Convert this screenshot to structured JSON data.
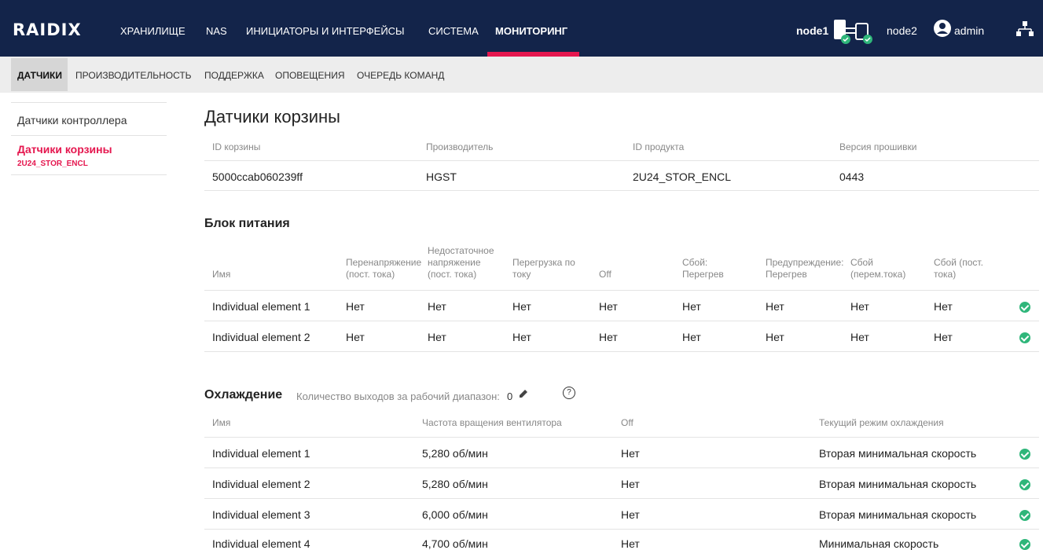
{
  "app": {
    "logo": "RAIDIX"
  },
  "topnav": {
    "items": [
      "ХРАНИЛИЩЕ",
      "NAS",
      "ИНИЦИАТОРЫ И ИНТЕРФЕЙСЫ",
      "СИСТЕМА",
      "МОНИТОРИНГ"
    ],
    "active_index": 4
  },
  "header": {
    "node1": "node1",
    "node2": "node2",
    "user": "admin"
  },
  "subnav": {
    "items": [
      "ДАТЧИКИ",
      "ПРОИЗВОДИТЕЛЬНОСТЬ",
      "ПОДДЕРЖКА",
      "ОПОВЕЩЕНИЯ",
      "ОЧЕРЕДЬ КОМАНД"
    ],
    "active_index": 0
  },
  "sidebar": {
    "items": [
      {
        "label": "Датчики контроллера",
        "sub": ""
      },
      {
        "label": "Датчики корзины",
        "sub": "2U24_STOR_ENCL"
      }
    ],
    "active_index": 1
  },
  "page": {
    "title": "Датчики корзины"
  },
  "enclosure": {
    "headers": [
      "ID корзины",
      "Производитель",
      "ID продукта",
      "Версия прошивки"
    ],
    "values": [
      "5000ccab060239ff",
      "HGST",
      "2U24_STOR_ENCL",
      "0443"
    ]
  },
  "psu": {
    "title": "Блок питания",
    "headers": [
      "Имя",
      "Перенапряжение (пост. тока)",
      "Недостаточное напряжение (пост. тока)",
      "Перегрузка по току",
      "Off",
      "Сбой: Перегрев",
      "Предупреждение: Перегрев",
      "Сбой (перем.тока)",
      "Сбой (пост. тока)"
    ],
    "rows": [
      {
        "name": "Individual element 1",
        "values": [
          "Нет",
          "Нет",
          "Нет",
          "Нет",
          "Нет",
          "Нет",
          "Нет",
          "Нет"
        ],
        "status": "ok"
      },
      {
        "name": "Individual element 2",
        "values": [
          "Нет",
          "Нет",
          "Нет",
          "Нет",
          "Нет",
          "Нет",
          "Нет",
          "Нет"
        ],
        "status": "ok"
      }
    ]
  },
  "cooling": {
    "title": "Охлаждение",
    "exits_label": "Количество выходов за рабочий диапазон:",
    "exits_value": "0",
    "help": "?",
    "headers": [
      "Имя",
      "Частота вращения вентилятора",
      "Off",
      "Текущий режим охлаждения"
    ],
    "rows": [
      {
        "name": "Individual element 1",
        "speed": "5,280 об/мин",
        "off": "Нет",
        "mode": "Вторая минимальная скорость",
        "status": "ok"
      },
      {
        "name": "Individual element 2",
        "speed": "5,280 об/мин",
        "off": "Нет",
        "mode": "Вторая минимальная скорость",
        "status": "ok"
      },
      {
        "name": "Individual element 3",
        "speed": "6,000 об/мин",
        "off": "Нет",
        "mode": "Вторая минимальная скорость",
        "status": "ok"
      },
      {
        "name": "Individual element 4",
        "speed": "4,700 об/мин",
        "off": "Нет",
        "mode": "Минимальная скорость",
        "status": "ok"
      }
    ]
  },
  "colors": {
    "nav_bg": "#13244a",
    "accent": "#e5174f",
    "ok": "#2fb67a"
  },
  "icons": {
    "ok": "check-circle-icon",
    "edit": "pencil-icon",
    "help": "help-circle-icon",
    "user": "user-circle-icon",
    "tree": "network-tree-icon",
    "node": "server-node-icon"
  }
}
